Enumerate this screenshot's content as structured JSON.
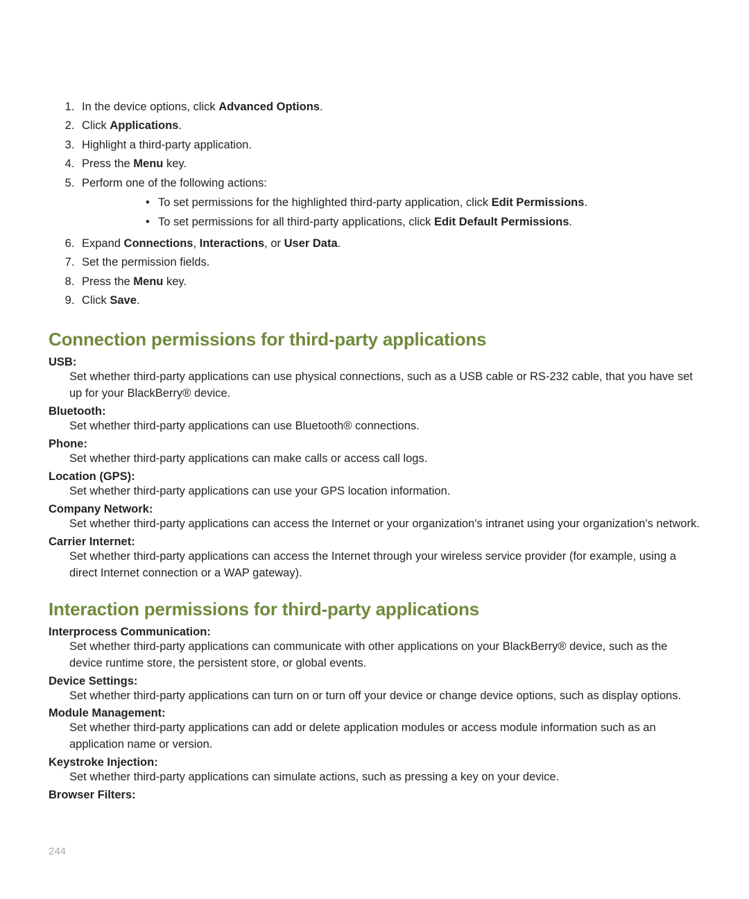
{
  "steps": [
    {
      "prefix": "In the device options, click ",
      "bold": "Advanced Options",
      "suffix": "."
    },
    {
      "prefix": "Click ",
      "bold": "Applications",
      "suffix": "."
    },
    {
      "prefix": "Highlight a third-party application.",
      "bold": "",
      "suffix": ""
    },
    {
      "prefix": "Press the ",
      "bold": "Menu",
      "suffix": " key."
    },
    {
      "prefix": "Perform one of the following actions:",
      "bold": "",
      "suffix": ""
    }
  ],
  "sub": [
    {
      "prefix": "To set permissions for the highlighted third-party application, click ",
      "bold": "Edit Permissions",
      "suffix": "."
    },
    {
      "prefix": "To set permissions for all third-party applications, click ",
      "bold": "Edit Default Permissions",
      "suffix": "."
    }
  ],
  "steps2": [
    {
      "prefix": "Expand ",
      "bold": "Connections",
      "mid": ", ",
      "bold2": "Interactions",
      "mid2": ", or ",
      "bold3": "User Data",
      "suffix": "."
    },
    {
      "prefix": "Set the permission fields.",
      "bold": "",
      "suffix": ""
    },
    {
      "prefix": "Press the ",
      "bold": "Menu",
      "suffix": " key."
    },
    {
      "prefix": "Click ",
      "bold": "Save",
      "suffix": "."
    }
  ],
  "section1": {
    "title": "Connection permissions for third-party applications",
    "items": [
      {
        "term": "USB:",
        "def": "Set whether third-party applications can use physical connections, such as a USB cable or RS-232 cable, that you have set up for your BlackBerry® device."
      },
      {
        "term": "Bluetooth:",
        "def": "Set whether third-party applications can use Bluetooth® connections."
      },
      {
        "term": "Phone:",
        "def": "Set whether third-party applications can make calls or access call logs."
      },
      {
        "term": "Location (GPS):",
        "def": "Set whether third-party applications can use your GPS location information."
      },
      {
        "term": "Company Network:",
        "def": "Set whether third-party applications can access the Internet or your organization's intranet using your organization's network."
      },
      {
        "term": "Carrier Internet:",
        "def": "Set whether third-party applications can access the Internet through your wireless service provider (for example, using a direct Internet connection or a WAP gateway)."
      }
    ]
  },
  "section2": {
    "title": "Interaction permissions for third-party applications",
    "items": [
      {
        "term": "Interprocess Communication:",
        "def": "Set whether third-party applications can communicate with other applications on your BlackBerry® device, such as the device runtime store, the persistent store, or global events."
      },
      {
        "term": "Device Settings:",
        "def": "Set whether third-party applications can turn on or turn off your device or change device options, such as display options."
      },
      {
        "term": "Module Management:",
        "def": "Set whether third-party applications can add or delete application modules or access module information such as an application name or version."
      },
      {
        "term": "Keystroke Injection:",
        "def": "Set whether third-party applications can simulate actions, such as pressing a key on your device."
      },
      {
        "term": "Browser Filters:",
        "def": ""
      }
    ]
  },
  "pagenum": "244"
}
